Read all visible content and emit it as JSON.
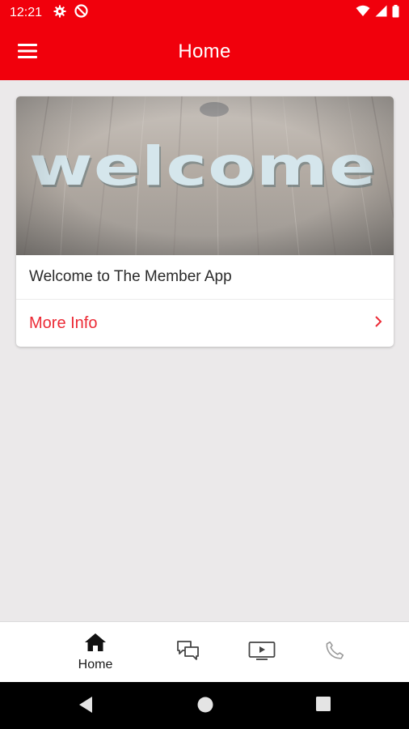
{
  "status_bar": {
    "time": "12:21",
    "icons": [
      "gear-icon",
      "do-not-disturb-icon",
      "wifi-icon",
      "signal-icon",
      "battery-icon"
    ]
  },
  "app_bar": {
    "title": "Home",
    "menu_icon": "hamburger-menu-icon"
  },
  "card": {
    "image_text": "welcome",
    "title": "Welcome to The Member App",
    "action_label": "More Info",
    "action_icon": "chevron-right-icon"
  },
  "bottom_nav": {
    "items": [
      {
        "label": "Home",
        "icon": "home-icon",
        "active": true
      },
      {
        "label": "",
        "icon": "chat-icon",
        "active": false
      },
      {
        "label": "",
        "icon": "video-icon",
        "active": false
      },
      {
        "label": "",
        "icon": "phone-icon",
        "active": false
      }
    ]
  },
  "system_nav": {
    "buttons": [
      "back-icon",
      "home-circle-icon",
      "recents-icon"
    ]
  },
  "colors": {
    "accent": "#f1000c",
    "link": "#ec2a35",
    "background": "#ebe9ea"
  }
}
